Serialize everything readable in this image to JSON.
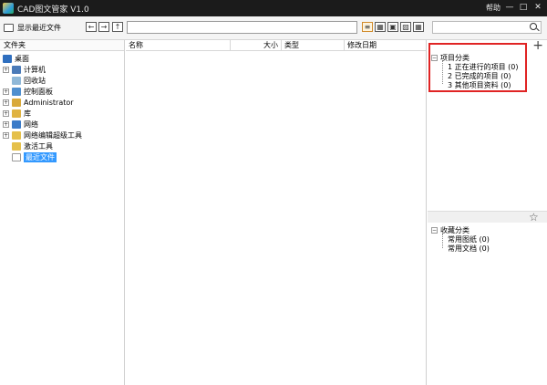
{
  "window": {
    "title": "CAD图文管家 V1.0",
    "help": "帮助",
    "min": "—",
    "max": "□",
    "close": "✕"
  },
  "toolbar": {
    "recent_label": "显示最近文件",
    "path_value": "",
    "search_value": ""
  },
  "left_panel": {
    "header": "文件夹",
    "items": [
      {
        "label": "桌面",
        "icon": "desktop-icon",
        "color": "#2f6fbf"
      },
      {
        "label": "计算机",
        "icon": "computer-icon",
        "color": "#4a7ab8"
      },
      {
        "label": "回收站",
        "icon": "recycle-bin-icon",
        "color": "#8fb8d8"
      },
      {
        "label": "控制面板",
        "icon": "control-panel-icon",
        "color": "#4f8fcf"
      },
      {
        "label": "Administrator",
        "icon": "user-icon",
        "color": "#d9a93a"
      },
      {
        "label": "库",
        "icon": "library-icon",
        "color": "#e0b341"
      },
      {
        "label": "网络",
        "icon": "network-icon",
        "color": "#3a7bc8"
      },
      {
        "label": "网络编辑超级工具",
        "icon": "folder-icon",
        "color": "#e5c04a"
      },
      {
        "label": "激活工具",
        "icon": "folder-icon",
        "color": "#e5c04a"
      },
      {
        "label": "最近文件",
        "icon": "file-icon",
        "color": "#ffffff"
      }
    ]
  },
  "center_panel": {
    "columns": [
      "名称",
      "大小",
      "类型",
      "修改日期"
    ]
  },
  "right_panel": {
    "project_root": "项目分类",
    "project_items": [
      "1 正在进行的项目 (0)",
      "2 已完成的项目 (0)",
      "3 其他项目资料 (0)"
    ],
    "fav_root": "收藏分类",
    "fav_items": [
      "常用图纸 (0)",
      "常用文档 (0)"
    ]
  },
  "colors": {
    "titlebar": "#1b1b1b",
    "selection": "#3399ff",
    "highlight_box": "#e02424"
  }
}
